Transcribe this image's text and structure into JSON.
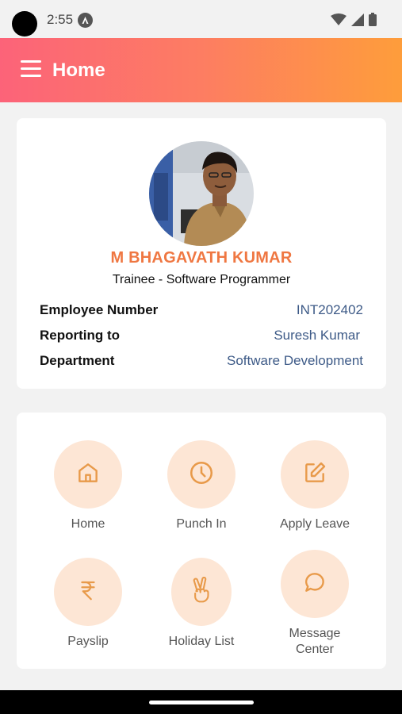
{
  "status_bar": {
    "time": "2:55"
  },
  "app_bar": {
    "title": "Home"
  },
  "profile": {
    "name": "M BHAGAVATH KUMAR",
    "role": "Trainee - Software Programmer",
    "details": [
      {
        "label": "Employee Number",
        "value": "INT202402"
      },
      {
        "label": "Reporting to",
        "value": "Suresh Kumar"
      },
      {
        "label": "Department",
        "value": "Software Development"
      }
    ]
  },
  "menu": {
    "items": [
      {
        "label": "Home",
        "icon": "home-icon"
      },
      {
        "label": "Punch In",
        "icon": "clock-icon"
      },
      {
        "label": "Apply Leave",
        "icon": "edit-icon"
      },
      {
        "label": "Payslip",
        "icon": "rupee-icon"
      },
      {
        "label": "Holiday List",
        "icon": "victory-hand-icon"
      },
      {
        "label": "Message Center",
        "icon": "chat-bubble-icon"
      }
    ]
  },
  "colors": {
    "accent": "#ef7742",
    "gradient_start": "#fc6379",
    "gradient_end": "#fe9d3b",
    "value_text": "#3d5a87",
    "tile_bg": "#fde6d5",
    "icon": "#e89a4a"
  }
}
